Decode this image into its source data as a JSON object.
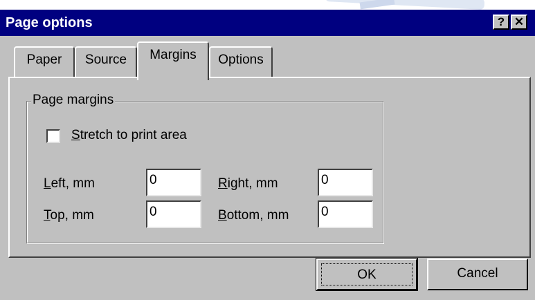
{
  "window": {
    "title": "Page options",
    "help_glyph": "?",
    "close_glyph": "✕"
  },
  "tabs": [
    {
      "label": "Paper",
      "active": false
    },
    {
      "label": "Source",
      "active": false
    },
    {
      "label": "Margins",
      "active": true
    },
    {
      "label": "Options",
      "active": false
    }
  ],
  "margins": {
    "group_title": "Page margins",
    "stretch": {
      "label_first": "S",
      "label_rest": "tretch to print area",
      "checked": false
    },
    "left": {
      "label_first": "L",
      "label_rest": "eft, mm",
      "value": "0"
    },
    "right": {
      "label_first": "R",
      "label_rest": "ight, mm",
      "value": "0"
    },
    "top": {
      "label_first": "T",
      "label_rest": "op, mm",
      "value": "0"
    },
    "bottom": {
      "label_first": "B",
      "label_rest": "ottom, mm",
      "value": "0"
    }
  },
  "buttons": {
    "ok": "OK",
    "cancel": "Cancel"
  }
}
